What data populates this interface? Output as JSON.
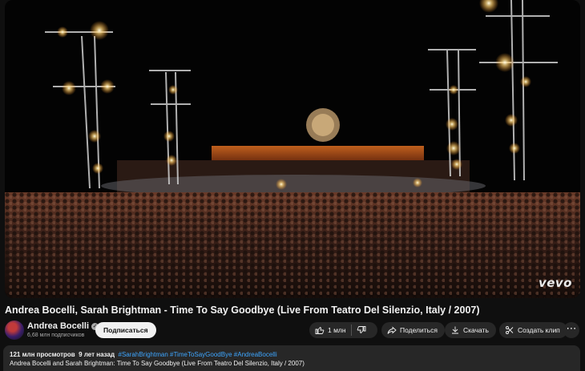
{
  "video": {
    "watermark": "vevo"
  },
  "title": "Andrea Bocelli, Sarah Brightman - Time To Say Goodbye (Live From Teatro Del Silenzio, Italy / 2007)",
  "channel": {
    "name": "Andrea Bocelli",
    "subscribers": "6,68 млн подписчиков",
    "subscribe_label": "Подписаться"
  },
  "actions": {
    "like_count": "1 млн",
    "share_label": "Поделиться",
    "download_label": "Скачать",
    "clip_label": "Создать клип",
    "more_label": "⋯"
  },
  "description": {
    "views": "121 млн просмотров",
    "age": "9 лет назад",
    "hashtags": [
      "#SarahBrightman",
      "#TimeToSayGoodBye",
      "#AndreaBocelli"
    ],
    "text": "Andrea Bocelli and Sarah Brightman: Time To Say Goodbye (Live From Teatro Del Silenzio, Italy / 2007)"
  },
  "icons": [
    "like-icon",
    "dislike-icon",
    "share-icon",
    "download-icon",
    "scissors-icon",
    "more-icon",
    "verified-icon"
  ],
  "colors": {
    "background": "#0f0f0f",
    "pill": "#272727",
    "hashtag": "#3ea6ff"
  }
}
